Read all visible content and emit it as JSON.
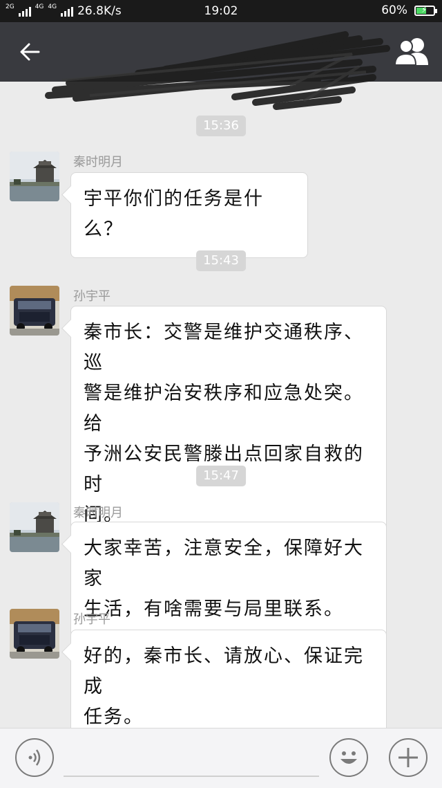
{
  "status_bar": {
    "network_1": "2G",
    "network_2": "4G",
    "network_3": "4G",
    "speed": "26.8K/s",
    "time": "19:02",
    "battery_percent": "60%",
    "battery_level": 0.6
  },
  "nav": {
    "back_icon": "back-arrow-icon",
    "contacts_icon": "group-contacts-icon"
  },
  "messages": [
    {
      "timestamp": "15:36",
      "sender": "秦时明月",
      "lines": [
        "宇平你们的任务是什么？"
      ]
    },
    {
      "timestamp": "15:43",
      "sender": "孙宇平",
      "lines": [
        "秦市长：交警是维护交通秩序、巡",
        "警是维护治安秩序和应急处突。给",
        "予洲公安民警滕出点回家自救的时",
        "间。"
      ]
    },
    {
      "timestamp": "15:47",
      "sender": "秦时明月",
      "lines": [
        "大家幸苦，注意安全，保障好大家",
        "生活，有啥需要与局里联系。"
      ]
    },
    {
      "timestamp": "",
      "sender": "孙宇平",
      "lines": [
        "好的，秦市长、请放心、保证完成",
        "任务。"
      ]
    }
  ],
  "input_bar": {
    "voice_icon": "voice-icon",
    "emoji_icon": "emoji-icon",
    "plus_icon": "plus-icon"
  }
}
